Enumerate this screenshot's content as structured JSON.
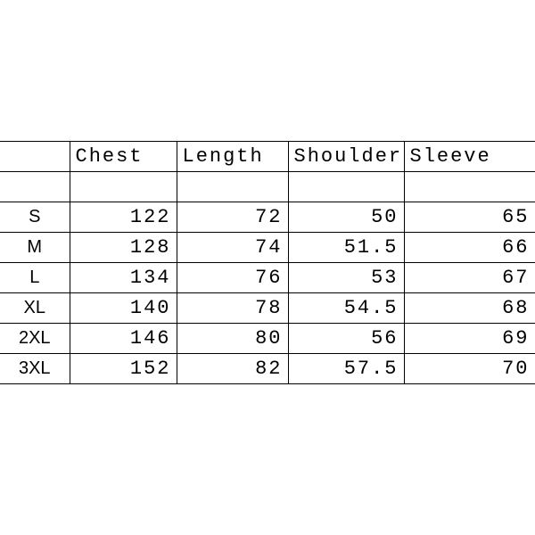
{
  "chart_data": {
    "type": "table",
    "columns": [
      "",
      "Chest",
      "Length",
      "Shoulder",
      "Sleeve"
    ],
    "rows": [
      {
        "size": "S",
        "chest": 122,
        "length": 72,
        "shoulder": 50,
        "sleeve": 65
      },
      {
        "size": "M",
        "chest": 128,
        "length": 74,
        "shoulder": 51.5,
        "sleeve": 66
      },
      {
        "size": "L",
        "chest": 134,
        "length": 76,
        "shoulder": 53,
        "sleeve": 67
      },
      {
        "size": "XL",
        "chest": 140,
        "length": 78,
        "shoulder": 54.5,
        "sleeve": 68
      },
      {
        "size": "2XL",
        "chest": 146,
        "length": 80,
        "shoulder": 56,
        "sleeve": 69
      },
      {
        "size": "3XL",
        "chest": 152,
        "length": 82,
        "shoulder": 57.5,
        "sleeve": 70
      }
    ]
  },
  "headers": {
    "c1": "Chest",
    "c2": "Length",
    "c3": "Shoulder",
    "c4": "Sleeve"
  },
  "rows": {
    "r0": {
      "size": "S",
      "chest": "122",
      "length": "72",
      "shoulder": "50",
      "sleeve": "65"
    },
    "r1": {
      "size": "M",
      "chest": "128",
      "length": "74",
      "shoulder": "51.5",
      "sleeve": "66"
    },
    "r2": {
      "size": "L",
      "chest": "134",
      "length": "76",
      "shoulder": "53",
      "sleeve": "67"
    },
    "r3": {
      "size": "XL",
      "chest": "140",
      "length": "78",
      "shoulder": "54.5",
      "sleeve": "68"
    },
    "r4": {
      "size": "2XL",
      "chest": "146",
      "length": "80",
      "shoulder": "56",
      "sleeve": "69"
    },
    "r5": {
      "size": "3XL",
      "chest": "152",
      "length": "82",
      "shoulder": "57.5",
      "sleeve": "70"
    }
  }
}
